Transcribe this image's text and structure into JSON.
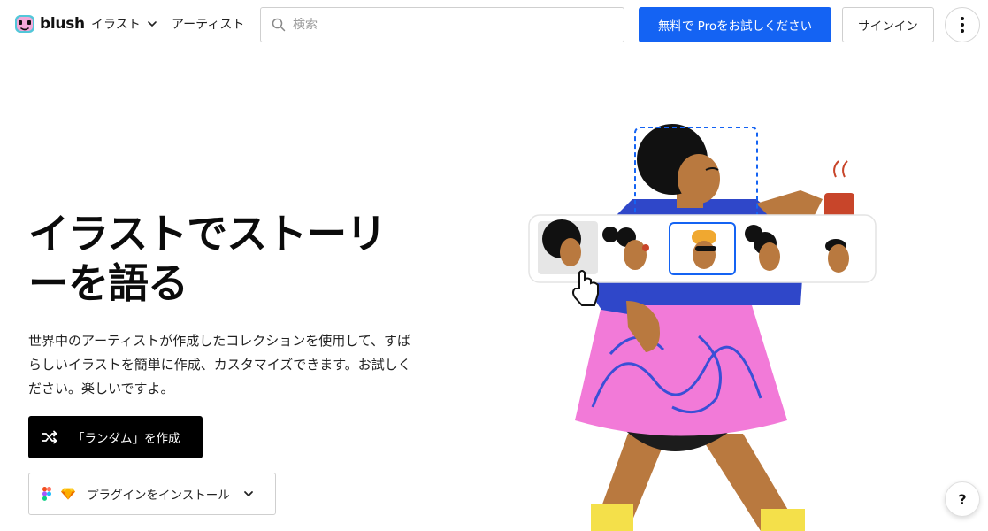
{
  "header": {
    "logo_text": "blush",
    "nav": {
      "illustrations": "イラスト",
      "artists": "アーティスト"
    },
    "search_placeholder": "検索",
    "pro_button": "無料で Proをお試しください",
    "signin_button": "サインイン"
  },
  "hero": {
    "title": "イラストでストーリーを語る",
    "description": "世界中のアーティストが作成したコレクションを使用して、すばらしいイラストを簡単に作成、カスタマイズできます。お試しください。楽しいですよ。",
    "random_button": "「ランダム」を作成",
    "plugin_button": "プラグインをインストール"
  },
  "help": {
    "label": "?"
  },
  "icons": {
    "logo": "blush-logo-icon",
    "chevron": "chevron-down-icon",
    "search": "search-icon",
    "more": "more-vertical-icon",
    "shuffle": "shuffle-icon",
    "figma": "figma-icon",
    "sketch": "sketch-icon"
  },
  "colors": {
    "primary": "#1463f3",
    "dark_button": "#000000",
    "skirt": "#f27ad8",
    "top": "#2f47c9",
    "skin": "#b9793f",
    "mug": "#c8452a"
  }
}
